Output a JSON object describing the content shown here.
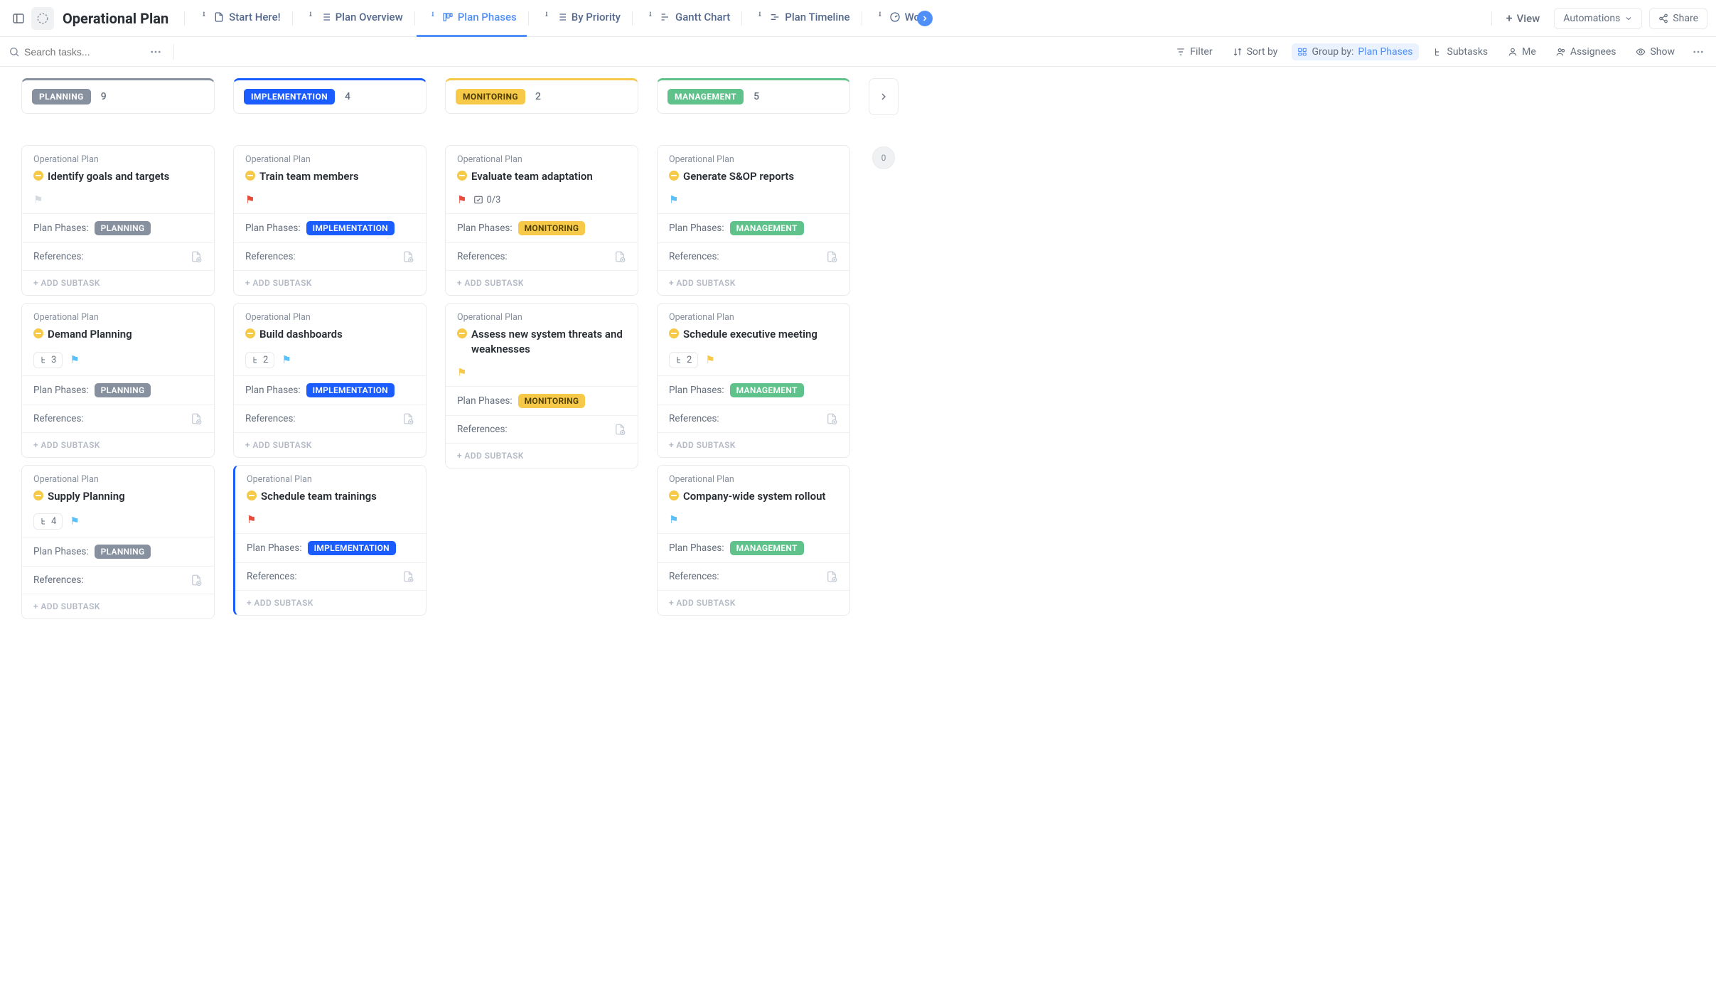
{
  "header": {
    "title": "Operational Plan",
    "views": {
      "start_here": "Start Here!",
      "plan_overview": "Plan Overview",
      "plan_phases": "Plan Phases",
      "by_priority": "By Priority",
      "gantt_chart": "Gantt Chart",
      "plan_timeline": "Plan Timeline",
      "workload_partial": "Wo"
    },
    "add_view": "View",
    "automations": "Automations",
    "share": "Share"
  },
  "toolbar": {
    "search_placeholder": "Search tasks...",
    "filter": "Filter",
    "sort_by": "Sort by",
    "group_by_label": "Group by:",
    "group_by_value": "Plan Phases",
    "subtasks": "Subtasks",
    "me": "Me",
    "assignees": "Assignees",
    "show": "Show"
  },
  "labels": {
    "plan_phases": "Plan Phases:",
    "references": "References:",
    "add_subtask": "+ ADD SUBTASK",
    "project_name": "Operational Plan"
  },
  "columns": {
    "planning": {
      "name": "PLANNING",
      "count": "9"
    },
    "implementation": {
      "name": "IMPLEMENTATION",
      "count": "4"
    },
    "monitoring": {
      "name": "MONITORING",
      "count": "2"
    },
    "management": {
      "name": "MANAGEMENT",
      "count": "5"
    },
    "next_count": "0"
  },
  "cards": {
    "p1": {
      "title": "Identify goals and targets"
    },
    "p2": {
      "title": "Demand Planning",
      "subtasks": "3"
    },
    "p3": {
      "title": "Supply Planning",
      "subtasks": "4"
    },
    "i1": {
      "title": "Train team members"
    },
    "i2": {
      "title": "Build dashboards",
      "subtasks": "2"
    },
    "i3": {
      "title": "Schedule team trainings"
    },
    "mo1": {
      "title": "Evaluate team adaptation",
      "checklist": "0/3"
    },
    "mo2": {
      "title": "Assess new system threats and weaknesses"
    },
    "mg1": {
      "title": "Generate S&OP reports"
    },
    "mg2": {
      "title": "Schedule executive meeting",
      "subtasks": "2"
    },
    "mg3": {
      "title": "Company-wide system rollout"
    }
  }
}
